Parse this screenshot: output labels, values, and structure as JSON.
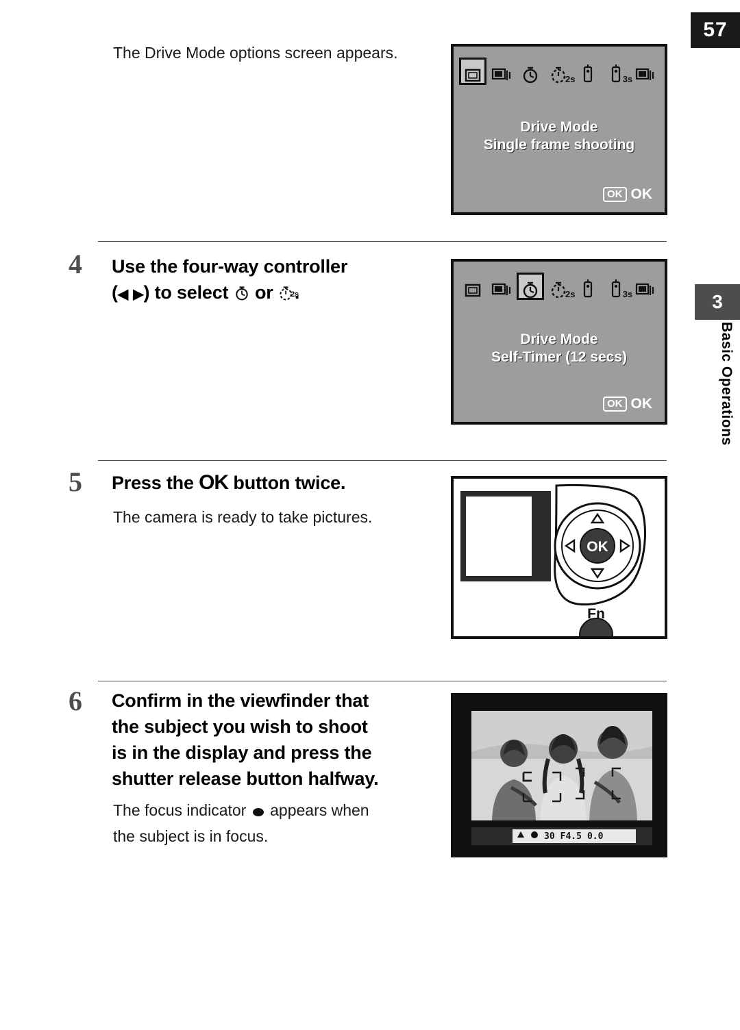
{
  "page": {
    "number": "57",
    "chapter_number": "3",
    "chapter_label": "Basic Operations"
  },
  "intro": {
    "text": "The Drive Mode options screen appears."
  },
  "screens": {
    "screen1": {
      "title": "Drive Mode",
      "subtitle": "Single frame shooting",
      "ok_badge": "OK",
      "ok_label": "OK",
      "icons": [
        "single-frame-icon",
        "continuous-shooting-icon",
        "self-timer-12s-icon",
        "self-timer-2s-icon",
        "remote-control-icon",
        "remote-control-3s-icon",
        "exposure-bracketing-icon"
      ],
      "selected_icon_index": 0,
      "icon_sublabels": [
        "",
        "",
        "",
        "2s",
        "",
        "3s",
        ""
      ]
    },
    "screen2": {
      "title": "Drive Mode",
      "subtitle": "Self-Timer (12 secs)",
      "ok_badge": "OK",
      "ok_label": "OK",
      "icons": [
        "single-frame-icon",
        "continuous-shooting-icon",
        "self-timer-12s-icon",
        "self-timer-2s-icon",
        "remote-control-icon",
        "remote-control-3s-icon",
        "exposure-bracketing-icon"
      ],
      "selected_icon_index": 2,
      "icon_sublabels": [
        "",
        "",
        "",
        "2s",
        "",
        "3s",
        ""
      ]
    }
  },
  "steps": [
    {
      "number": "4",
      "title_line1": "Use the four-way controller",
      "title_line2_a": "(",
      "title_line2_left_arrow": "◀",
      "title_line2_right_arrow": "▶",
      "title_line2_b": ") to select",
      "title_line2_c": "or",
      "title_line2_d": "."
    },
    {
      "number": "5",
      "title_a": "Press the",
      "title_ok": "OK",
      "title_b": "button twice.",
      "body": "The camera is ready to take pictures."
    },
    {
      "number": "6",
      "title_line1": "Confirm in the viewfinder that",
      "title_line2": "the subject you wish to shoot",
      "title_line3": "is in the display and press the",
      "title_line4": "shutter release button halfway.",
      "body_a": "The focus indicator",
      "body_b": "appears when",
      "body_c": "the subject is in focus."
    }
  ],
  "camera_illustration": {
    "ok_button_label": "OK",
    "fn_button_label": "Fn"
  },
  "viewfinder": {
    "readout_shutter": "30",
    "readout_aperture": "F4.5",
    "readout_ev": "0.0"
  },
  "colors": {
    "tab_dark": "#1a1a1a",
    "tab_grey": "#4d4d4d",
    "lcd_grey": "#9d9d9d",
    "text": "#1a1a1a"
  }
}
